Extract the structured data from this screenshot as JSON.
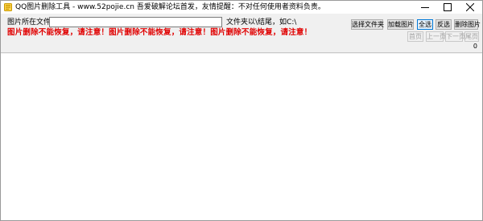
{
  "window": {
    "title": "QQ图片删除工具 - www.52pojie.cn 吾爱破解论坛首发，友情提醒：不对任何使用者资料负责。"
  },
  "form": {
    "folder_label": "图片所在文件夹:",
    "folder_value": "",
    "folder_hint": "文件夹以\\结尾，如C:\\"
  },
  "warning": "图片删除不能恢复，请注意！图片删除不能恢复，请注意！图片删除不能恢复，请注意！",
  "toolbar": {
    "select_folder": "选择文件夹",
    "load_images": "加载图片",
    "select_all": "全选",
    "invert": "反选",
    "delete_images": "删除图片"
  },
  "pager": {
    "first": "首页",
    "prev": "上一页",
    "next": "下一页",
    "last": "尾页",
    "count": "0"
  },
  "colors": {
    "warning": "#e00000",
    "accent": "#0078d7"
  }
}
